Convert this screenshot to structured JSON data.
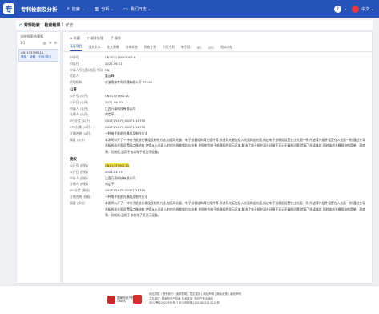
{
  "app": {
    "logo_glyph": "专",
    "title": "专利检索及分析",
    "nav": [
      {
        "icon": "search-icon",
        "glyph": "⌕",
        "label": "检索 ⌄"
      },
      {
        "icon": "chart-icon",
        "glyph": "▥",
        "label": "分析 ⌄"
      },
      {
        "icon": "folder-icon",
        "glyph": "▭",
        "label": "我们日志 ⌄"
      }
    ],
    "help_glyph": "?",
    "user_label": "⌄",
    "lang_label": "中文 ⌄"
  },
  "breadcrumb": {
    "home_glyph": "⌂",
    "part1": "常规检索",
    "sep1": "|",
    "part2": "检索结果",
    "sep2": "|",
    "part3": "详览"
  },
  "sidebar": {
    "header": "当前检索结果集",
    "count_label": "1/1",
    "tools": [
      "▤",
      "☰",
      "⚙"
    ],
    "items": [
      {
        "id": "CN115379021A",
        "meta": [
          "详细",
          "收藏",
          "分析/导出"
        ]
      }
    ]
  },
  "toolbar": {
    "items": [
      "◆ 收藏",
      "▽ 翻译处理",
      "⤴ 操作"
    ]
  },
  "tabs": [
    "著录项目",
    "全文文本",
    "全文图像",
    "法律状态",
    "同族专利",
    "引证专利",
    "被引证",
    "IPC",
    "CPC",
    "相似文献"
  ],
  "biblio": {
    "rows": [
      {
        "k": "申请号",
        "v": "CN202110097053.6"
      },
      {
        "k": "申请日",
        "v": "2021.06.11"
      },
      {
        "k": "申请人所在国(地区)代码",
        "v": "CN"
      },
      {
        "k": "代理人",
        "v": "姜云峰"
      },
      {
        "k": "代理机构",
        "v": "宁波甬致专利代理有限公司 33228"
      }
    ]
  },
  "pub": {
    "title": "公开",
    "rows": [
      {
        "k": "公开号 (公开)",
        "v": "CN113379021A"
      },
      {
        "k": "公开日 (公开)",
        "v": "2021.09.10"
      },
      {
        "k": "申请人 (公开)",
        "v": "江西万泰科技有限公司"
      },
      {
        "k": "发明人 (公开)",
        "v": "刘定平"
      },
      {
        "k": "IPC分类 (公开)",
        "v": "G02F1/1675;G02F1/16755"
      },
      {
        "k": "CPC分类 (公开)",
        "v": "G02F1/1675;G02F1/16755"
      },
      {
        "k": "发明名称 (公开)",
        "v": "一种电子纸前光模组及制作方法"
      },
      {
        "k": "摘要 (公开)",
        "v": "本发明公开了一种电子纸前光模组及制作方法,包括导光板、电子纸模组和背光组件等,所述导光板包括入光面和出光面,所述电子纸模组设置在出光面一侧,所述背光组件设置在入光面一侧,通过在导光板的出光面设置网点微结构,使得从入光面入射的光线能够均匀出射,并照射到电子纸模组的显示区域,解决了电子纸在弱光环境下显示不清的问题,提高了阅读体验,同时该前光模组结构简单、厚度薄、功耗低,适用于各类电子纸显示设备。"
      }
    ]
  },
  "grant": {
    "title": "授权",
    "rows": [
      {
        "k": "公开号 (授权)",
        "v": "CN113379021B",
        "hl": true
      },
      {
        "k": "公开日 (授权)",
        "v": "2024.04.05"
      },
      {
        "k": "申请人 (授权)",
        "v": "江西万泰科技有限公司"
      },
      {
        "k": "发明人 (授权)",
        "v": "刘定平"
      },
      {
        "k": "IPC分类 (授权)",
        "v": "G02F1/1675;G02F1/16755"
      },
      {
        "k": "发明名称 (授权)",
        "v": "一种电子纸前光模组及制作方法"
      },
      {
        "k": "摘要 (授权)",
        "v": "本发明公开了一种电子纸前光模组及制作方法,包括导光板、电子纸模组和背光组件等,所述导光板包括入光面和出光面,所述电子纸模组设置在出光面一侧,所述背光组件设置在入光面一侧,通过在导光板的出光面设置网点微结构,使得从入光面入射的光线能够均匀出射,并照射到电子纸模组的显示区域,解决了电子纸在弱光环境下显示不清的问题,提高了阅读体验,同时该前光模组结构简单、厚度薄、功耗低,适用于各类电子纸显示设备。"
      }
    ]
  },
  "footer": {
    "org1": "国家知识产权局",
    "org1_sub": "CNIPA",
    "links_line1": "网站导航 | 联系我们 | 使用帮助 | 意见建议 | 网站声明 | 隐私政策 | 版权声明",
    "links_line2": "主办单位: 国家知识产权局  技术支持: 知识产权出版社",
    "links_line3": "京ICP备12002359号-1  京公网安备11010802013210号"
  }
}
